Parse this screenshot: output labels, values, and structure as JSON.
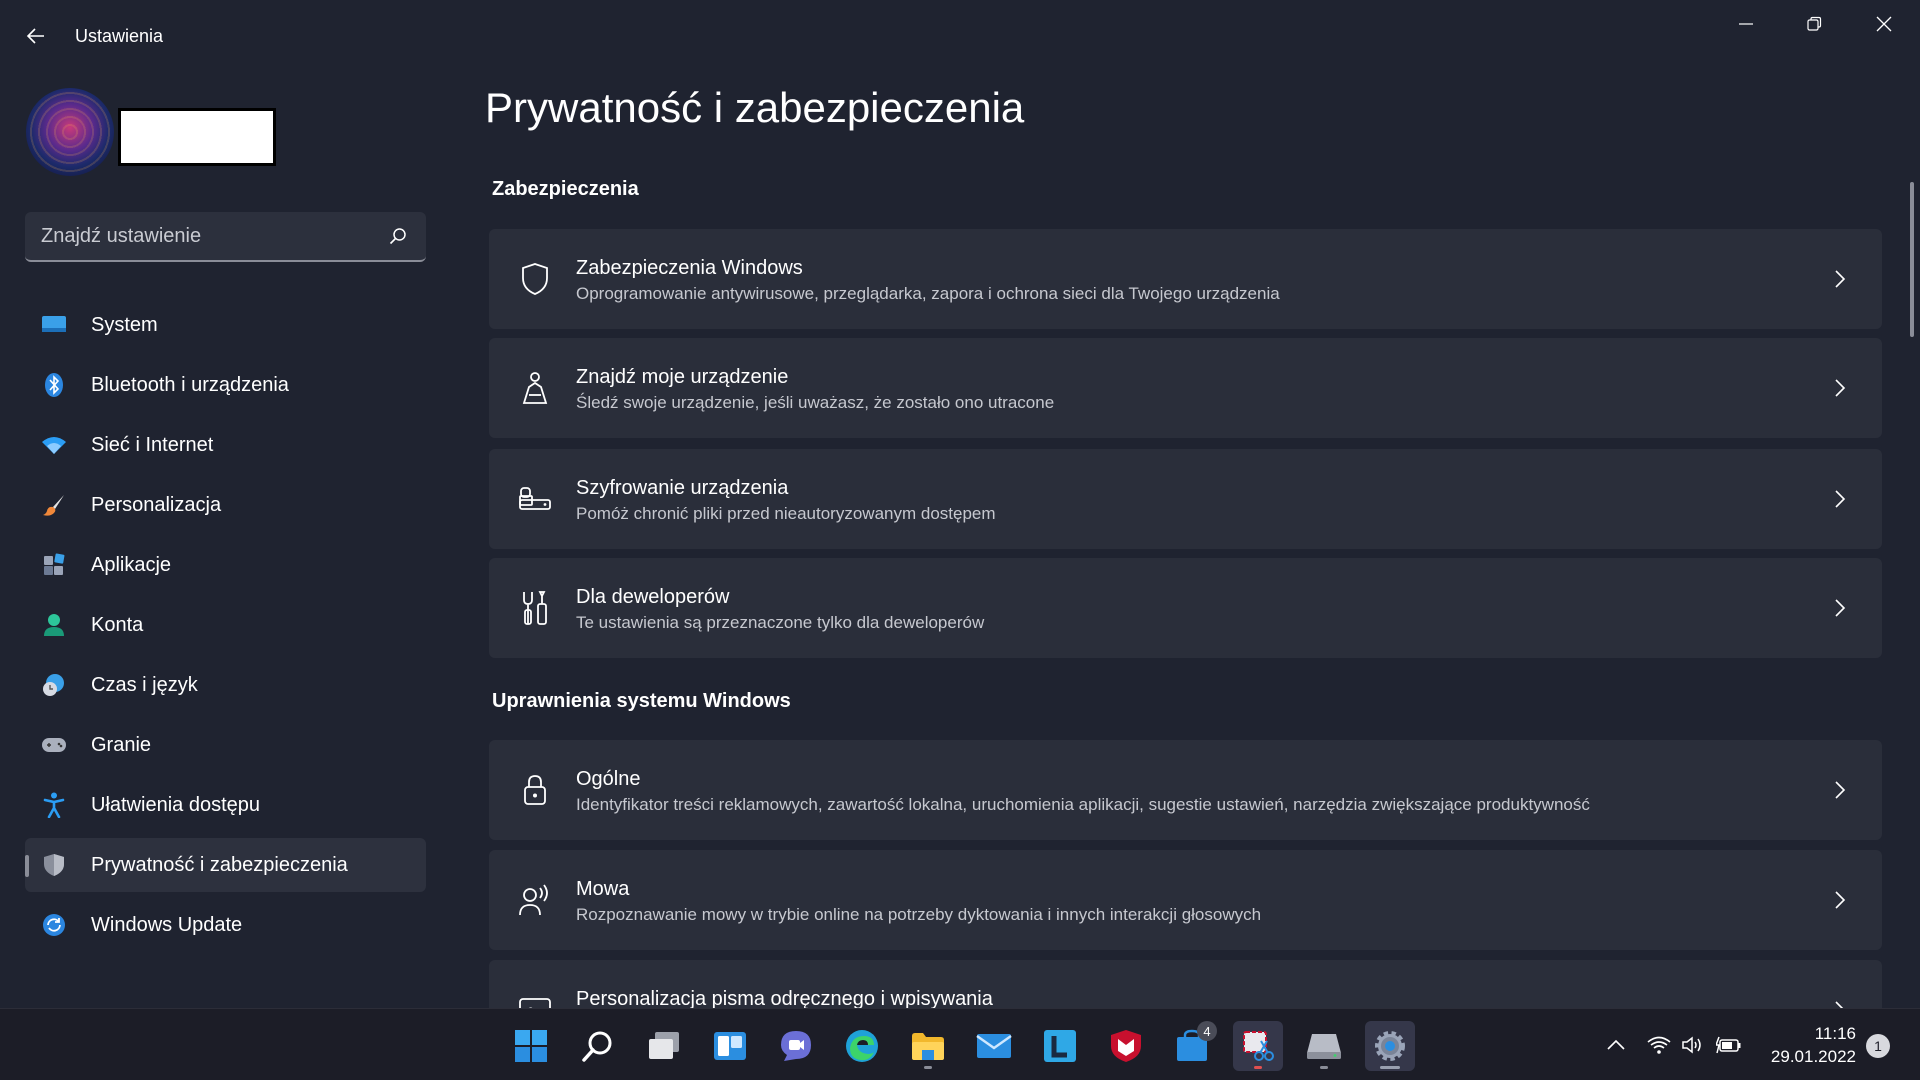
{
  "window": {
    "title": "Ustawienia"
  },
  "sidebar": {
    "search_placeholder": "Znajdź ustawienie",
    "items": [
      {
        "label": "System",
        "icon": "system-display-icon"
      },
      {
        "label": "Bluetooth i urządzenia",
        "icon": "bluetooth-icon"
      },
      {
        "label": "Sieć i Internet",
        "icon": "wifi-network-icon"
      },
      {
        "label": "Personalizacja",
        "icon": "paintbrush-icon"
      },
      {
        "label": "Aplikacje",
        "icon": "apps-icon"
      },
      {
        "label": "Konta",
        "icon": "account-person-icon"
      },
      {
        "label": "Czas i język",
        "icon": "time-language-icon"
      },
      {
        "label": "Granie",
        "icon": "gamepad-icon"
      },
      {
        "label": "Ułatwienia dostępu",
        "icon": "accessibility-icon"
      },
      {
        "label": "Prywatność i zabezpieczenia",
        "icon": "privacy-shield-icon",
        "active": true
      },
      {
        "label": "Windows Update",
        "icon": "windows-update-icon"
      }
    ]
  },
  "main": {
    "page_title": "Prywatność i zabezpieczenia",
    "sections": [
      {
        "title": "Zabezpieczenia",
        "cards": [
          {
            "title": "Zabezpieczenia Windows",
            "subtitle": "Oprogramowanie antywirusowe, przeglądarka, zapora i ochrona sieci dla Twojego urządzenia",
            "icon": "shield-icon"
          },
          {
            "title": "Znajdź moje urządzenie",
            "subtitle": "Śledź swoje urządzenie, jeśli uważasz, że zostało ono utracone",
            "icon": "find-device-person-icon"
          },
          {
            "title": "Szyfrowanie urządzenia",
            "subtitle": "Pomóż chronić pliki przed nieautoryzowanym dostępem",
            "icon": "encryption-lock-drive-icon"
          },
          {
            "title": "Dla deweloperów",
            "subtitle": "Te ustawienia są przeznaczone tylko dla deweloperów",
            "icon": "developer-tools-icon"
          }
        ]
      },
      {
        "title": "Uprawnienia systemu Windows",
        "cards": [
          {
            "title": "Ogólne",
            "subtitle": "Identyfikator treści reklamowych, zawartość lokalna, uruchomienia aplikacji, sugestie ustawień, narzędzia zwiększające produktywność",
            "icon": "lock-icon"
          },
          {
            "title": "Mowa",
            "subtitle": "Rozpoznawanie mowy w trybie online na potrzeby dyktowania i innych interakcji głosowych",
            "icon": "speech-person-icon"
          },
          {
            "title": "Personalizacja pisma odręcznego i wpisywania",
            "subtitle": "",
            "icon": "handwriting-icon"
          }
        ]
      }
    ]
  },
  "taskbar": {
    "apps": [
      {
        "name": "start-button",
        "icon": "windows-logo-icon"
      },
      {
        "name": "search-button",
        "icon": "search-icon"
      },
      {
        "name": "task-view-button",
        "icon": "task-view-icon"
      },
      {
        "name": "widgets-button",
        "icon": "widgets-icon"
      },
      {
        "name": "chat-button",
        "icon": "teams-chat-icon"
      },
      {
        "name": "edge-button",
        "icon": "edge-browser-icon"
      },
      {
        "name": "file-explorer-button",
        "icon": "folder-icon"
      },
      {
        "name": "mail-button",
        "icon": "mail-icon"
      },
      {
        "name": "app-l-button",
        "icon": "letter-l-icon"
      },
      {
        "name": "mcafee-button",
        "icon": "mcafee-shield-icon"
      },
      {
        "name": "store-button",
        "icon": "store-icon",
        "badge": "4"
      },
      {
        "name": "snipping-tool-button",
        "icon": "snipping-tool-icon"
      },
      {
        "name": "drive-button",
        "icon": "drive-icon"
      },
      {
        "name": "settings-button",
        "icon": "settings-gear-icon"
      }
    ],
    "clock": {
      "time": "11:16",
      "date": "29.01.2022"
    },
    "notifications": "1"
  },
  "colors": {
    "background": "#1f2330",
    "card": "#2a2e3a",
    "accent_blue": "#2b9df4",
    "taskbar": "#1c1d27"
  }
}
